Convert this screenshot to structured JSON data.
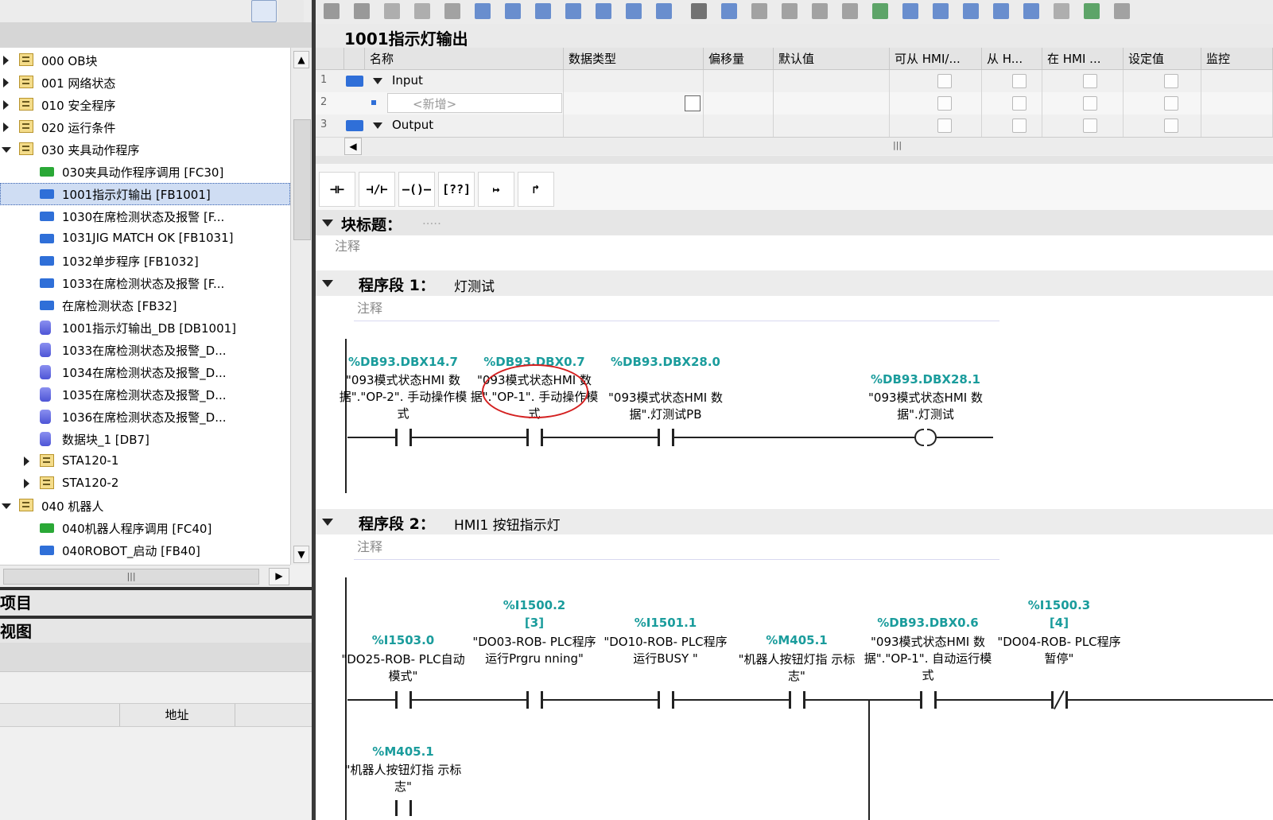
{
  "tree": {
    "items": [
      {
        "label": "000 OB块",
        "kind": "folder",
        "expand": "right",
        "indent": 0
      },
      {
        "label": "001 网络状态",
        "kind": "folder",
        "expand": "right",
        "indent": 0
      },
      {
        "label": "010 安全程序",
        "kind": "folder",
        "expand": "right",
        "indent": 0
      },
      {
        "label": "020 运行条件",
        "kind": "folder",
        "expand": "right",
        "indent": 0
      },
      {
        "label": "030 夹具动作程序",
        "kind": "folder",
        "expand": "down",
        "indent": 0
      },
      {
        "label": "030夹具动作程序调用 [FC30]",
        "kind": "fc",
        "indent": 1
      },
      {
        "label": "1001指示灯输出 [FB1001]",
        "kind": "fb",
        "indent": 1,
        "selected": true
      },
      {
        "label": "1030在席检测状态及报警 [F...",
        "kind": "fb",
        "indent": 1
      },
      {
        "label": "1031JIG MATCH OK [FB1031]",
        "kind": "fb",
        "indent": 1
      },
      {
        "label": "1032单步程序 [FB1032]",
        "kind": "fb",
        "indent": 1
      },
      {
        "label": "1033在席检测状态及报警 [F...",
        "kind": "fb",
        "indent": 1
      },
      {
        "label": "在席检测状态 [FB32]",
        "kind": "fb",
        "indent": 1
      },
      {
        "label": "1001指示灯输出_DB [DB1001]",
        "kind": "db",
        "indent": 1
      },
      {
        "label": "1033在席检测状态及报警_D...",
        "kind": "db",
        "indent": 1
      },
      {
        "label": "1034在席检测状态及报警_D...",
        "kind": "db",
        "indent": 1
      },
      {
        "label": "1035在席检测状态及报警_D...",
        "kind": "db",
        "indent": 1
      },
      {
        "label": "1036在席检测状态及报警_D...",
        "kind": "db",
        "indent": 1
      },
      {
        "label": "数据块_1 [DB7]",
        "kind": "db",
        "indent": 1
      },
      {
        "label": "STA120-1",
        "kind": "folder",
        "expand": "right",
        "indent": 1
      },
      {
        "label": "STA120-2",
        "kind": "folder",
        "expand": "right",
        "indent": 1
      },
      {
        "label": "040 机器人",
        "kind": "folder",
        "expand": "down",
        "indent": 0
      },
      {
        "label": "040机器人程序调用 [FC40]",
        "kind": "fc",
        "indent": 1
      },
      {
        "label": "040ROBOT_启动 [FB40]",
        "kind": "fb",
        "indent": 1
      }
    ],
    "hscroll_grip": "|||"
  },
  "panes": {
    "project_title": "项目",
    "view_title": "视图",
    "address_header": "地址"
  },
  "editor": {
    "block_name": "1001指示灯输出",
    "interface": {
      "headers": [
        "名称",
        "数据类型",
        "偏移量",
        "默认值",
        "可从 HMI/...",
        "从 H...",
        "在 HMI ...",
        "设定值",
        "监控"
      ],
      "rows": [
        {
          "num": "1",
          "name": "Input",
          "kind": "section"
        },
        {
          "num": "2",
          "name": "<新增>",
          "kind": "new"
        },
        {
          "num": "3",
          "name": "Output",
          "kind": "section"
        }
      ],
      "hscroll_grip": "|||"
    },
    "lad_buttons": [
      "⊣⊢",
      "⊣/⊢",
      "–()–",
      "[??]",
      "↦",
      "↱"
    ],
    "block_title_label": "块标题：",
    "block_comment": "注释",
    "networks": [
      {
        "title": "程序段 1：",
        "subtitle": "灯测试",
        "comment": "注释",
        "elements": [
          {
            "addr": "%DB93.DBX14.7",
            "name": "\"093模式状态HMI 数据\".\"OP-2\". 手动操作模式",
            "type": "NO"
          },
          {
            "addr": "%DB93.DBX0.7",
            "name": "\"093模式状态HMI 数据\".\"OP-1\". 手动操作模式",
            "type": "NO",
            "highlight": true
          },
          {
            "addr": "%DB93.DBX28.0",
            "name": "\"093模式状态HMI 数据\".灯测试PB",
            "type": "NO"
          },
          {
            "addr": "%DB93.DBX28.1",
            "name": "\"093模式状态HMI 数据\".灯测试",
            "type": "COIL"
          }
        ]
      },
      {
        "title": "程序段 2：",
        "subtitle": "HMI1 按钮指示灯",
        "comment": "注释",
        "elements": [
          {
            "addr": "%I1503.0",
            "name": "\"DO25-ROB- PLC自动模式\"",
            "type": "NO"
          },
          {
            "addr": "%I1500.2",
            "index": "[3]",
            "name": "\"DO03-ROB- PLC程序运行Prgru nning\"",
            "type": "NO"
          },
          {
            "addr": "%I1501.1",
            "name": "\"DO10-ROB- PLC程序运行BUSY \"",
            "type": "NO"
          },
          {
            "addr": "%M405.1",
            "name": "\"机器人按钮灯指 示标志\"",
            "type": "NO"
          },
          {
            "addr": "%DB93.DBX0.6",
            "name": "\"093模式状态HMI 数据\".\"OP-1\". 自动运行模式",
            "type": "NO"
          },
          {
            "addr": "%I1500.3",
            "index": "[4]",
            "name": "\"DO04-ROB- PLC程序暂停\"",
            "type": "NC"
          }
        ],
        "branch": {
          "addr": "%M405.1",
          "name": "\"机器人按钮灯指 示标志\"",
          "type": "NO"
        }
      }
    ]
  },
  "colors": {
    "address": "#1a9c9c",
    "selection": "#cfddf3",
    "annotation": "#d42020",
    "fb_icon": "#2f6fd8",
    "fc_icon": "#2aa836"
  }
}
